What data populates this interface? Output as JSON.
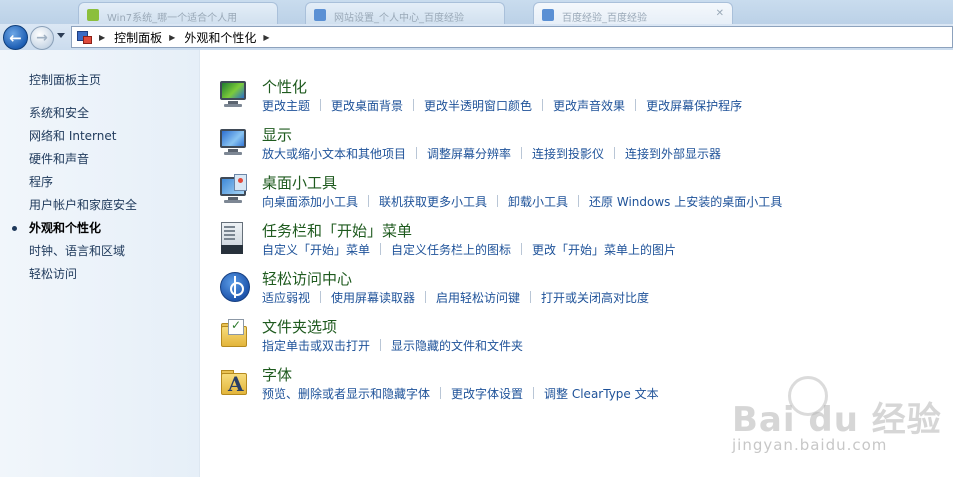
{
  "browser": {
    "tabs": [
      {
        "label": "Win7系统_哪一个适合个人用",
        "kind": "fav"
      },
      {
        "label": "网站设置_个人中心_百度经验",
        "kind": "doc"
      },
      {
        "label": "百度经验_百度经验",
        "kind": "doc"
      }
    ],
    "close_glyph": "✕"
  },
  "address": {
    "breadcrumbs": [
      "控制面板",
      "外观和个性化"
    ],
    "separator": "▶"
  },
  "sidebar": {
    "home": "控制面板主页",
    "items": [
      {
        "label": "系统和安全",
        "current": false
      },
      {
        "label": "网络和 Internet",
        "current": false
      },
      {
        "label": "硬件和声音",
        "current": false
      },
      {
        "label": "程序",
        "current": false
      },
      {
        "label": "用户帐户和家庭安全",
        "current": false
      },
      {
        "label": "外观和个性化",
        "current": true
      },
      {
        "label": "时钟、语言和区域",
        "current": false
      },
      {
        "label": "轻松访问",
        "current": false
      }
    ]
  },
  "categories": [
    {
      "title": "个性化",
      "icon": "personalization-icon",
      "links": [
        "更改主题",
        "更改桌面背景",
        "更改半透明窗口颜色",
        "更改声音效果",
        "更改屏幕保护程序"
      ]
    },
    {
      "title": "显示",
      "icon": "display-icon",
      "links": [
        "放大或缩小文本和其他项目",
        "调整屏幕分辨率",
        "连接到投影仪",
        "连接到外部显示器"
      ]
    },
    {
      "title": "桌面小工具",
      "icon": "gadgets-icon",
      "links": [
        "向桌面添加小工具",
        "联机获取更多小工具",
        "卸载小工具",
        "还原 Windows 上安装的桌面小工具"
      ]
    },
    {
      "title": "任务栏和「开始」菜单",
      "icon": "taskbar-icon",
      "links": [
        "自定义「开始」菜单",
        "自定义任务栏上的图标",
        "更改「开始」菜单上的图片"
      ]
    },
    {
      "title": "轻松访问中心",
      "icon": "ease-of-access-icon",
      "links": [
        "适应弱视",
        "使用屏幕读取器",
        "启用轻松访问键",
        "打开或关闭高对比度"
      ]
    },
    {
      "title": "文件夹选项",
      "icon": "folder-options-icon",
      "links": [
        "指定单击或双击打开",
        "显示隐藏的文件和文件夹"
      ]
    },
    {
      "title": "字体",
      "icon": "fonts-icon",
      "links": [
        "预览、删除或者显示和隐藏字体",
        "更改字体设置",
        "调整 ClearType 文本"
      ]
    }
  ],
  "watermark": {
    "brand": "Bai  du 经验",
    "site": "jingyan.baidu.com"
  },
  "colors": {
    "title": "#1e5a1e",
    "link": "#1e5299",
    "nav": "#1e395b",
    "sidebar_bg": "#e6eff8"
  }
}
